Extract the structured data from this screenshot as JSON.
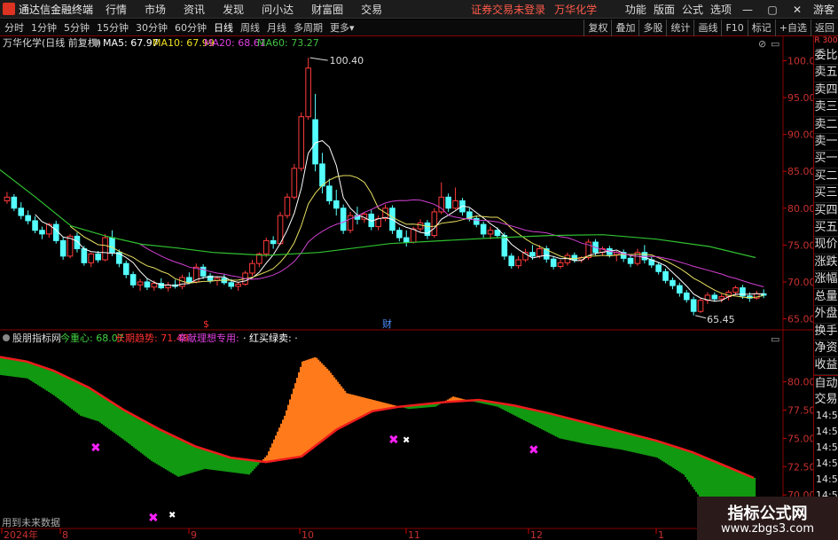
{
  "menubar": {
    "app_name": "通达信金融终端",
    "items": [
      "行情",
      "市场",
      "资讯",
      "发现",
      "问小达",
      "财富圈",
      "交易"
    ],
    "status": "证券交易未登录",
    "stock": "万华化学",
    "right_items": [
      "功能",
      "版面",
      "公式",
      "选项"
    ],
    "user": "游客"
  },
  "tabs": {
    "periods": [
      "分时",
      "1分钟",
      "5分钟",
      "15分钟",
      "30分钟",
      "60分钟",
      "日线",
      "周线",
      "月线",
      "多周期",
      "更多"
    ],
    "active": "日线",
    "right_buttons": [
      "复权",
      "叠加",
      "多股",
      "统计",
      "画线",
      "F10",
      "标记",
      "+自选",
      "返回"
    ]
  },
  "main_chart": {
    "title": "万华化学(日线 前复权)",
    "ma_labels": [
      {
        "text": "MA5: 67.97",
        "color": "#ffffff"
      },
      {
        "text": "MA10: 67.99",
        "color": "#f0e020"
      },
      {
        "text": "MA20: 68.61",
        "color": "#e040e0"
      },
      {
        "text": "MA60: 73.27",
        "color": "#40c040"
      }
    ],
    "high_label": "100.40",
    "low_label": "65.45",
    "markers": [
      "$",
      "财"
    ]
  },
  "indicator": {
    "title": "股朋指标网",
    "labels": [
      {
        "text": "今重心: 68.07",
        "color": "#40d040"
      },
      {
        "text": "长期趋势: 71.48",
        "color": "#ff3030"
      },
      {
        "text": "奉献理想专用:",
        "color": "#e040e0"
      },
      {
        "text": "· 红买绿卖: ·",
        "color": "#ffffff"
      }
    ]
  },
  "x_axis": {
    "labels": [
      "2024年",
      "8",
      "9",
      "10",
      "11",
      "12",
      "1"
    ]
  },
  "right_panel": {
    "corner": "R 300",
    "items": [
      "委比",
      "卖五",
      "卖四",
      "卖三",
      "卖二",
      "卖一",
      "买一",
      "买二",
      "买三",
      "买四",
      "买五",
      "现价",
      "涨跌",
      "涨幅",
      "总量",
      "外盘",
      "换手",
      "净资",
      "收益"
    ],
    "items2": [
      "自动",
      "交易"
    ],
    "times": [
      "14:56",
      "14:56",
      "14:56",
      "14:56",
      "14:56",
      "14:56",
      "14:56",
      "14:56"
    ]
  },
  "future_data": "用到未来数据",
  "watermark": {
    "line1": "指标公式网",
    "line2": "www.zbgs3.com"
  },
  "chart_data": [
    {
      "type": "candlestick",
      "title": "万华化学(日线 前复权)",
      "y_ticks": [
        65.0,
        70.0,
        75.0,
        80.0,
        85.0,
        90.0,
        95.0,
        100.0
      ],
      "ylim": [
        63.5,
        101.5
      ],
      "x_labels": [
        "2024年",
        "8",
        "9",
        "10",
        "11",
        "12",
        "1"
      ],
      "candles": [
        [
          81.0,
          82.2,
          80.6,
          81.5
        ],
        [
          81.5,
          81.9,
          79.6,
          80.0
        ],
        [
          80.0,
          80.8,
          78.5,
          79.0
        ],
        [
          79.0,
          79.7,
          77.8,
          78.3
        ],
        [
          78.3,
          78.9,
          76.6,
          77.0
        ],
        [
          77.0,
          77.5,
          75.8,
          76.5
        ],
        [
          76.5,
          78.0,
          76.0,
          77.8
        ],
        [
          77.8,
          78.3,
          75.2,
          75.6
        ],
        [
          75.6,
          76.0,
          73.0,
          73.5
        ],
        [
          73.5,
          76.5,
          73.2,
          76.2
        ],
        [
          76.2,
          76.7,
          74.0,
          74.5
        ],
        [
          74.5,
          74.9,
          72.2,
          72.6
        ],
        [
          72.6,
          74.0,
          72.0,
          73.8
        ],
        [
          73.8,
          74.2,
          72.6,
          73.0
        ],
        [
          73.0,
          76.5,
          72.8,
          76.0
        ],
        [
          76.0,
          77.0,
          73.5,
          74.0
        ],
        [
          74.0,
          74.4,
          72.0,
          72.5
        ],
        [
          72.5,
          72.9,
          70.5,
          71.0
        ],
        [
          71.0,
          71.4,
          69.2,
          69.6
        ],
        [
          69.6,
          70.4,
          68.8,
          70.0
        ],
        [
          70.0,
          70.5,
          68.9,
          69.3
        ],
        [
          69.3,
          70.2,
          68.8,
          69.8
        ],
        [
          69.8,
          70.5,
          69.0,
          69.2
        ],
        [
          69.2,
          70.0,
          68.7,
          69.6
        ],
        [
          69.6,
          70.3,
          69.1,
          69.4
        ],
        [
          69.4,
          71.0,
          69.0,
          70.6
        ],
        [
          70.6,
          71.3,
          69.8,
          70.0
        ],
        [
          70.0,
          72.5,
          69.8,
          72.0
        ],
        [
          72.0,
          72.4,
          70.4,
          70.8
        ],
        [
          70.8,
          71.2,
          69.8,
          70.2
        ],
        [
          70.2,
          70.8,
          69.5,
          70.5
        ],
        [
          70.5,
          71.0,
          69.6,
          69.9
        ],
        [
          69.9,
          70.4,
          69.0,
          69.4
        ],
        [
          69.4,
          70.0,
          68.8,
          69.7
        ],
        [
          69.7,
          71.5,
          69.5,
          71.2
        ],
        [
          71.2,
          73.0,
          70.8,
          72.5
        ],
        [
          72.5,
          74.0,
          72.0,
          73.8
        ],
        [
          73.8,
          76.0,
          73.4,
          75.6
        ],
        [
          75.6,
          76.2,
          74.5,
          75.2
        ],
        [
          75.2,
          79.5,
          75.0,
          79.0
        ],
        [
          79.0,
          82.0,
          78.6,
          81.5
        ],
        [
          81.5,
          86.0,
          81.2,
          85.4
        ],
        [
          85.4,
          93.0,
          85.0,
          92.4
        ],
        [
          92.4,
          100.4,
          92.0,
          99.0
        ],
        [
          92.0,
          95.5,
          85.0,
          86.0
        ],
        [
          86.0,
          87.5,
          82.0,
          83.0
        ],
        [
          83.0,
          84.0,
          80.5,
          81.0
        ],
        [
          81.0,
          82.5,
          79.0,
          80.0
        ],
        [
          80.0,
          80.5,
          76.5,
          77.0
        ],
        [
          77.0,
          79.5,
          76.6,
          79.0
        ],
        [
          79.0,
          80.2,
          77.8,
          78.5
        ],
        [
          78.5,
          79.5,
          78.0,
          79.2
        ],
        [
          79.2,
          79.8,
          77.0,
          77.5
        ],
        [
          77.5,
          79.0,
          77.0,
          78.6
        ],
        [
          78.6,
          80.5,
          78.2,
          80.0
        ],
        [
          80.0,
          80.4,
          76.5,
          77.0
        ],
        [
          77.0,
          77.4,
          75.5,
          76.0
        ],
        [
          76.0,
          77.0,
          74.8,
          75.4
        ],
        [
          75.4,
          77.5,
          75.2,
          77.2
        ],
        [
          77.2,
          78.5,
          76.8,
          78.0
        ],
        [
          78.0,
          78.4,
          75.8,
          76.3
        ],
        [
          76.3,
          80.0,
          76.0,
          79.5
        ],
        [
          79.5,
          83.5,
          79.2,
          81.5
        ],
        [
          81.5,
          82.0,
          79.5,
          80.0
        ],
        [
          80.0,
          82.8,
          79.8,
          81.0
        ],
        [
          81.0,
          81.4,
          79.0,
          79.5
        ],
        [
          79.5,
          80.0,
          78.2,
          78.6
        ],
        [
          78.6,
          79.0,
          77.4,
          77.8
        ],
        [
          77.8,
          78.2,
          76.0,
          76.5
        ],
        [
          76.5,
          77.5,
          75.8,
          77.0
        ],
        [
          77.0,
          77.4,
          75.9,
          76.3
        ],
        [
          76.3,
          76.7,
          73.0,
          73.5
        ],
        [
          73.5,
          73.9,
          71.8,
          72.2
        ],
        [
          72.2,
          73.5,
          71.8,
          73.0
        ],
        [
          73.0,
          74.5,
          72.7,
          74.0
        ],
        [
          74.0,
          75.0,
          73.0,
          73.5
        ],
        [
          73.5,
          75.0,
          73.2,
          74.5
        ],
        [
          74.5,
          74.9,
          72.6,
          73.1
        ],
        [
          73.1,
          73.5,
          71.7,
          72.1
        ],
        [
          72.1,
          73.0,
          71.8,
          72.6
        ],
        [
          72.6,
          74.0,
          72.2,
          73.6
        ],
        [
          73.6,
          74.0,
          72.6,
          73.0
        ],
        [
          73.0,
          73.5,
          72.6,
          73.3
        ],
        [
          73.3,
          75.8,
          73.0,
          75.4
        ],
        [
          75.4,
          75.8,
          73.6,
          74.0
        ],
        [
          74.0,
          74.8,
          73.5,
          74.5
        ],
        [
          74.5,
          74.9,
          73.3,
          73.7
        ],
        [
          73.7,
          74.2,
          72.8,
          74.0
        ],
        [
          74.0,
          74.4,
          72.7,
          73.2
        ],
        [
          73.2,
          73.6,
          72.0,
          72.5
        ],
        [
          72.5,
          74.5,
          72.2,
          74.0
        ],
        [
          74.0,
          75.0,
          72.5,
          73.0
        ],
        [
          73.0,
          73.4,
          71.9,
          72.3
        ],
        [
          72.3,
          72.7,
          71.0,
          71.4
        ],
        [
          71.4,
          71.8,
          69.8,
          70.2
        ],
        [
          70.2,
          70.6,
          69.0,
          69.5
        ],
        [
          69.5,
          69.9,
          68.0,
          68.5
        ],
        [
          68.5,
          68.9,
          67.2,
          67.6
        ],
        [
          67.6,
          68.0,
          65.45,
          66.0
        ],
        [
          66.0,
          67.8,
          65.8,
          67.5
        ],
        [
          67.5,
          68.6,
          67.0,
          68.2
        ],
        [
          68.2,
          68.6,
          67.3,
          67.7
        ],
        [
          67.7,
          68.4,
          67.2,
          68.0
        ],
        [
          68.0,
          68.9,
          67.5,
          68.6
        ],
        [
          68.6,
          69.5,
          68.2,
          69.2
        ],
        [
          69.2,
          69.6,
          67.7,
          68.1
        ],
        [
          68.1,
          68.6,
          67.3,
          67.8
        ],
        [
          67.8,
          68.8,
          67.6,
          68.4
        ],
        [
          68.4,
          69.0,
          67.8,
          68.2
        ]
      ],
      "ma60": [
        [
          0,
          85.2
        ],
        [
          40,
          81.5
        ],
        [
          80,
          77.6
        ],
        [
          120,
          76.2
        ],
        [
          160,
          75.1
        ],
        [
          200,
          74.6
        ],
        [
          240,
          74.0
        ],
        [
          300,
          73.6
        ],
        [
          360,
          74.0
        ],
        [
          440,
          75.2
        ],
        [
          500,
          75.6
        ],
        [
          560,
          76.0
        ],
        [
          620,
          76.3
        ],
        [
          680,
          76.4
        ],
        [
          740,
          75.8
        ],
        [
          800,
          74.8
        ],
        [
          852,
          73.3
        ]
      ]
    },
    {
      "type": "area",
      "title": "股朋指标网",
      "y_ticks": [
        70.0,
        72.5,
        75.0,
        77.5,
        80.0
      ],
      "ylim": [
        67.5,
        83.5
      ],
      "long_trend": [
        [
          0,
          82.2
        ],
        [
          30,
          81.8
        ],
        [
          60,
          81.0
        ],
        [
          100,
          79.5
        ],
        [
          140,
          77.5
        ],
        [
          180,
          75.8
        ],
        [
          220,
          74.3
        ],
        [
          260,
          73.3
        ],
        [
          300,
          72.9
        ],
        [
          340,
          73.4
        ],
        [
          380,
          75.8
        ],
        [
          420,
          77.4
        ],
        [
          450,
          77.8
        ],
        [
          500,
          78.2
        ],
        [
          540,
          78.4
        ],
        [
          580,
          77.9
        ],
        [
          620,
          77.2
        ],
        [
          660,
          76.4
        ],
        [
          700,
          75.6
        ],
        [
          740,
          74.8
        ],
        [
          780,
          73.8
        ],
        [
          820,
          72.5
        ],
        [
          850,
          71.5
        ]
      ],
      "center": [
        [
          0,
          80.6
        ],
        [
          30,
          80.3
        ],
        [
          60,
          78.8
        ],
        [
          90,
          77.0
        ],
        [
          110,
          76.5
        ],
        [
          140,
          74.8
        ],
        [
          170,
          73.0
        ],
        [
          200,
          71.6
        ],
        [
          230,
          72.3
        ],
        [
          260,
          72.0
        ],
        [
          280,
          71.8
        ],
        [
          300,
          73.5
        ],
        [
          320,
          77.0
        ],
        [
          340,
          81.8
        ],
        [
          355,
          82.2
        ],
        [
          370,
          81.0
        ],
        [
          390,
          79.0
        ],
        [
          430,
          78.2
        ],
        [
          460,
          77.6
        ],
        [
          490,
          77.8
        ],
        [
          510,
          78.7
        ],
        [
          530,
          78.3
        ],
        [
          560,
          77.8
        ],
        [
          600,
          76.2
        ],
        [
          630,
          75.0
        ],
        [
          660,
          74.5
        ],
        [
          700,
          74.0
        ],
        [
          740,
          73.3
        ],
        [
          770,
          71.8
        ],
        [
          790,
          69.6
        ],
        [
          820,
          69.0
        ],
        [
          852,
          68.5
        ]
      ],
      "markers": [
        {
          "x": 108,
          "y": 74.2,
          "type": "pink"
        },
        {
          "x": 173,
          "y": 68.0,
          "type": "pink"
        },
        {
          "x": 194,
          "y": 68.3,
          "type": "white"
        },
        {
          "x": 444,
          "y": 74.9,
          "type": "pink"
        },
        {
          "x": 458,
          "y": 74.9,
          "type": "white"
        },
        {
          "x": 602,
          "y": 74.0,
          "type": "pink"
        },
        {
          "x": 780,
          "y": 65.6,
          "type": "white"
        }
      ]
    }
  ]
}
